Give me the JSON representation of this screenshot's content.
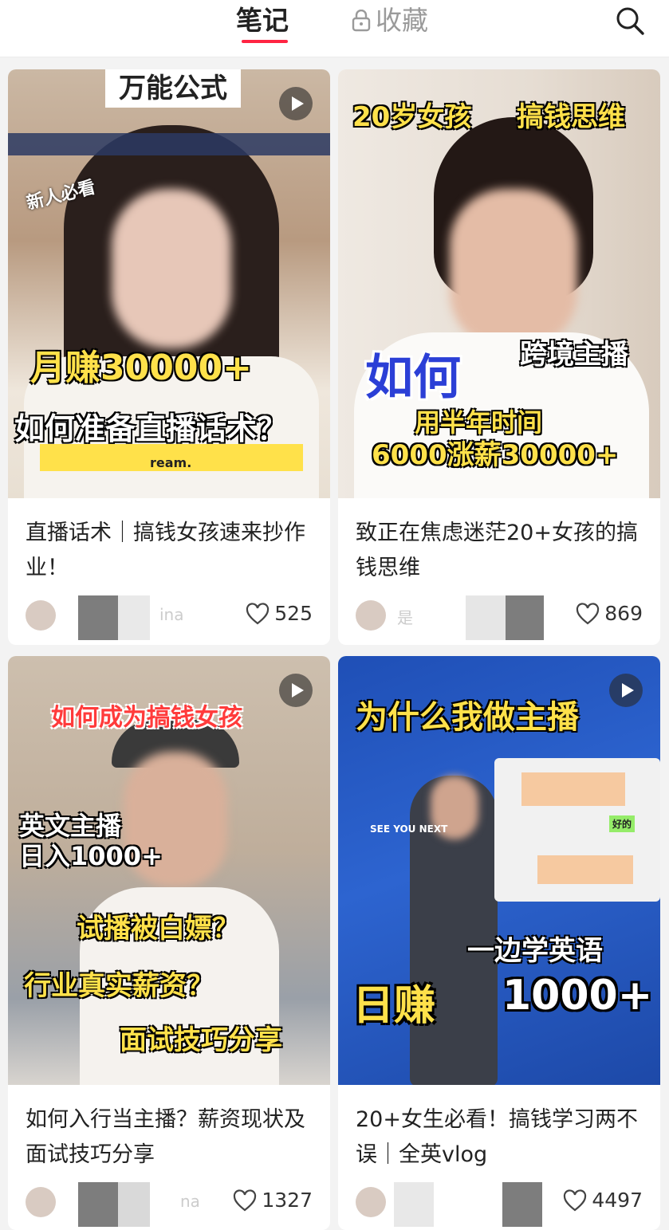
{
  "tabs": {
    "notes": "笔记",
    "favorites": "收藏"
  },
  "icons": {
    "search": "search-icon",
    "lock": "lock-icon",
    "play": "play-icon",
    "heart": "heart-icon"
  },
  "colors": {
    "accent": "#ff2442"
  },
  "cards": [
    {
      "title": "直播话术｜搞钱女孩速来抄作业！",
      "likes": "525",
      "author": "ina",
      "thumb_text": [
        "万能公式",
        "新人必看",
        "月赚30000+",
        "如何准备直播话术？",
        "ream."
      ]
    },
    {
      "title": "致正在焦虑迷茫20+女孩的搞钱思维",
      "likes": "869",
      "author": "是",
      "thumb_text": [
        "20岁女孩",
        "搞钱思维",
        "如何",
        "跨境主播",
        "用半年时间",
        "6000涨薪30000+"
      ]
    },
    {
      "title": "如何入行当主播？薪资现状及面试技巧分享",
      "likes": "1327",
      "author": "na",
      "thumb_text": [
        "如何成为搞钱女孩",
        "英文主播",
        "日入1000+",
        "试播被白嫖？",
        "行业真实薪资？",
        "面试技巧分享"
      ]
    },
    {
      "title": "20+女生必看！搞钱学习两不误｜全英vlog",
      "likes": "4497",
      "author": "",
      "thumb_text": [
        "为什么我做主播",
        "一边学英语",
        "日赚",
        "1000+",
        "好的",
        "SEE YOU NEXT"
      ]
    }
  ]
}
